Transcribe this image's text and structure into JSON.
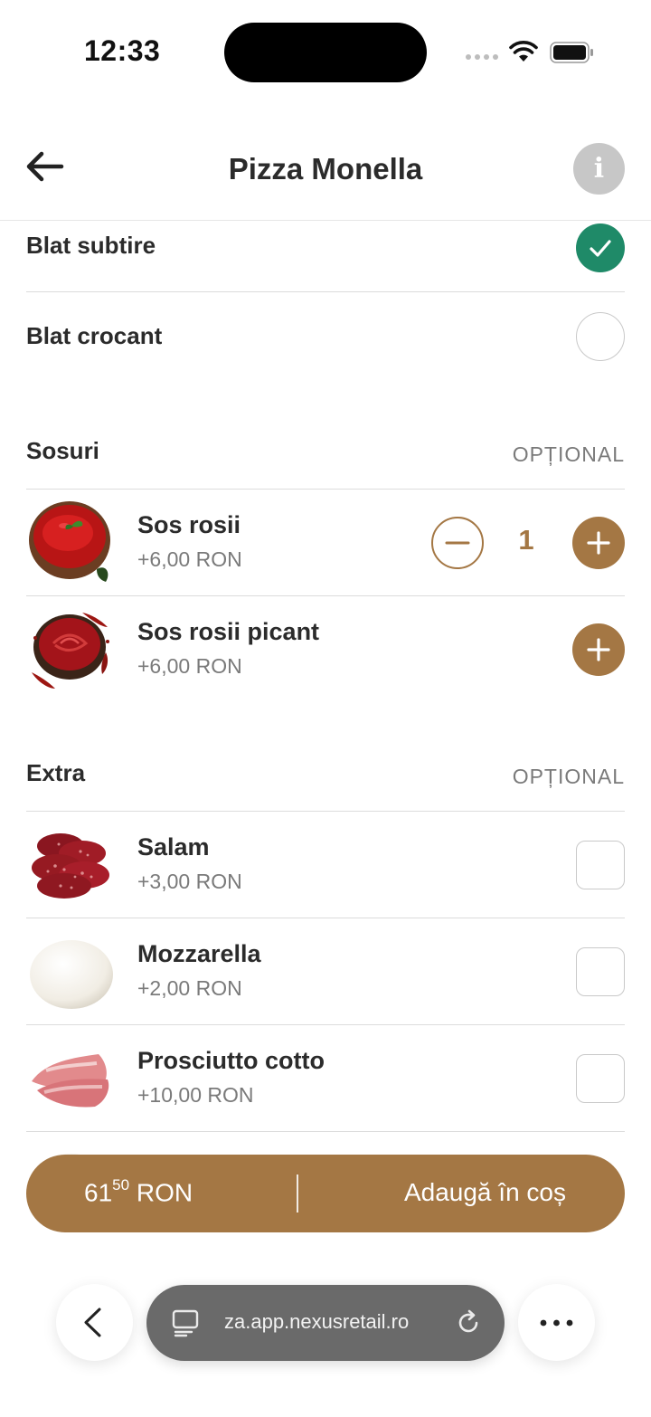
{
  "status_bar": {
    "time": "12:33"
  },
  "header": {
    "title": "Pizza Monella"
  },
  "crust_options": [
    {
      "label": "Blat subtire",
      "selected": true
    },
    {
      "label": "Blat crocant",
      "selected": false
    }
  ],
  "sauces": {
    "title": "Sosuri",
    "optional_label": "OPȚIONAL",
    "items": [
      {
        "name": "Sos rosii",
        "price": "+6,00 RON",
        "quantity": "1"
      },
      {
        "name": "Sos rosii picant",
        "price": "+6,00 RON"
      }
    ]
  },
  "extras": {
    "title": "Extra",
    "optional_label": "OPȚIONAL",
    "items": [
      {
        "name": "Salam",
        "price": "+3,00 RON"
      },
      {
        "name": "Mozzarella",
        "price": "+2,00 RON"
      },
      {
        "name": "Prosciutto cotto",
        "price": "+10,00 RON"
      }
    ]
  },
  "cart": {
    "total_integer": "61",
    "total_decimal": "50",
    "currency": "RON",
    "add_label": "Adaugă în coș"
  },
  "browser": {
    "url": "za.app.nexusretail.ro"
  },
  "colors": {
    "accent": "#a47744",
    "selected": "#1f8a68"
  },
  "icons": [
    "back-arrow-icon",
    "info-icon",
    "checkmark-icon",
    "minus-icon",
    "plus-icon",
    "chevron-left-icon",
    "tabs-icon",
    "reload-icon",
    "more-icon"
  ]
}
